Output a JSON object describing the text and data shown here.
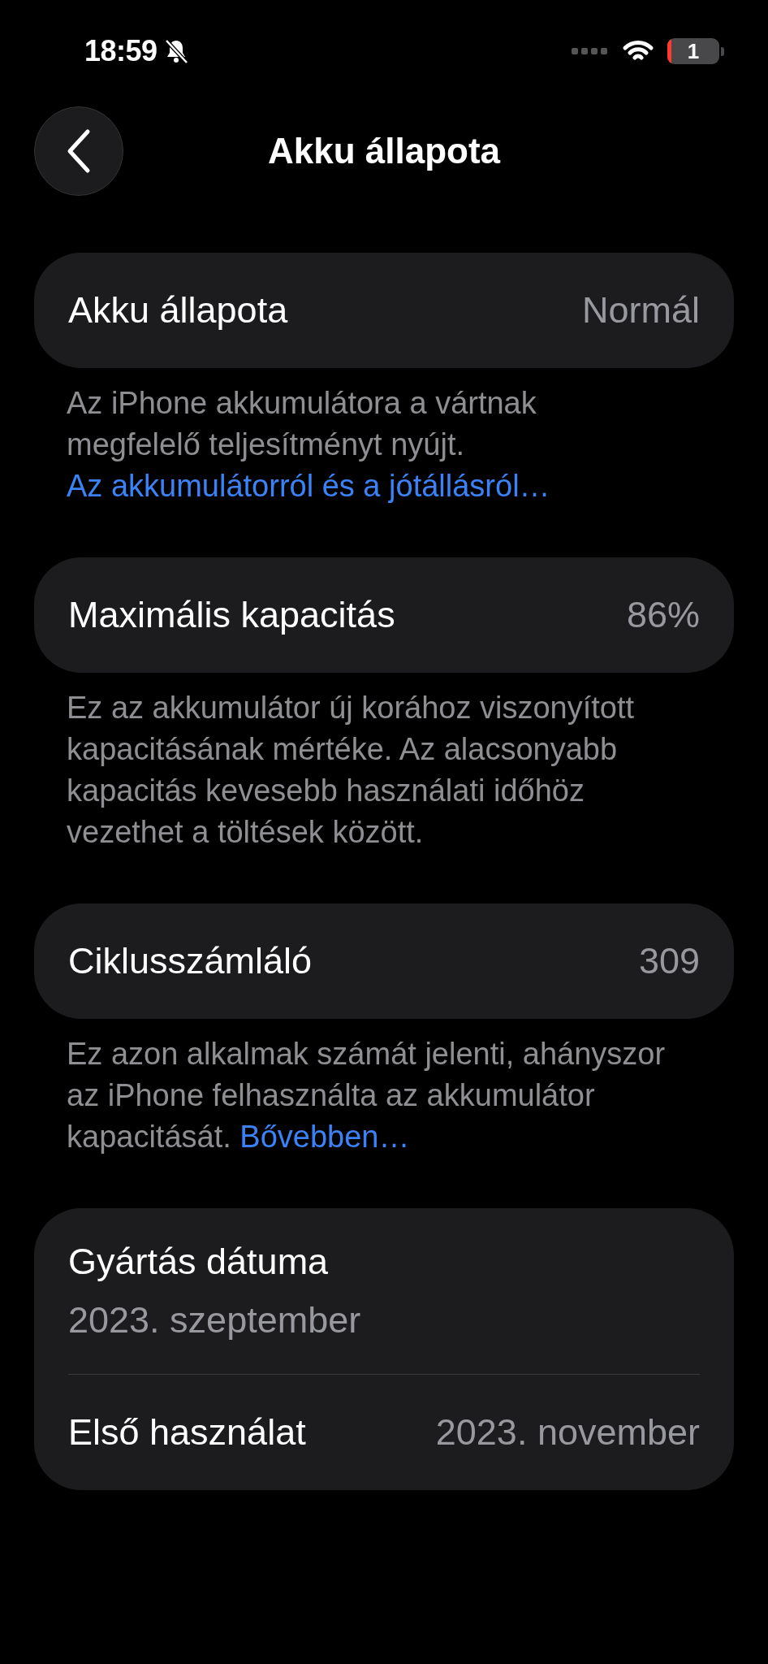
{
  "status_bar": {
    "time": "18:59",
    "silent": true,
    "battery_text": "1"
  },
  "nav": {
    "title": "Akku állapota"
  },
  "sections": [
    {
      "kind": "row",
      "label": "Akku állapota",
      "value": "Normál",
      "footer": {
        "text": "Az iPhone akkumulátora a vártnak megfelelő teljesítményt nyújt.",
        "link": "Az akkumulátorról és a jótállásról…"
      }
    },
    {
      "kind": "row",
      "label": "Maximális kapacitás",
      "value": "86%",
      "footer": {
        "text": "Ez az akkumulátor új korához viszonyított kapacitásának mértéke. Az alacsonyabb kapacitás kevesebb használati időhöz vezethet a töltések között."
      }
    },
    {
      "kind": "row",
      "label": "Ciklusszámláló",
      "value": "309",
      "footer": {
        "text": "Ez azon alkalmak számát jelenti, ahányszor az iPhone felhasználta az akkumulátor kapacitását.",
        "link": "Bővebben…"
      }
    },
    {
      "kind": "group",
      "rows": [
        {
          "kind": "stacked",
          "label": "Gyártás dátuma",
          "value": "2023. szeptember"
        },
        {
          "kind": "inline",
          "label": "Első használat",
          "value": "2023. november"
        }
      ]
    }
  ]
}
